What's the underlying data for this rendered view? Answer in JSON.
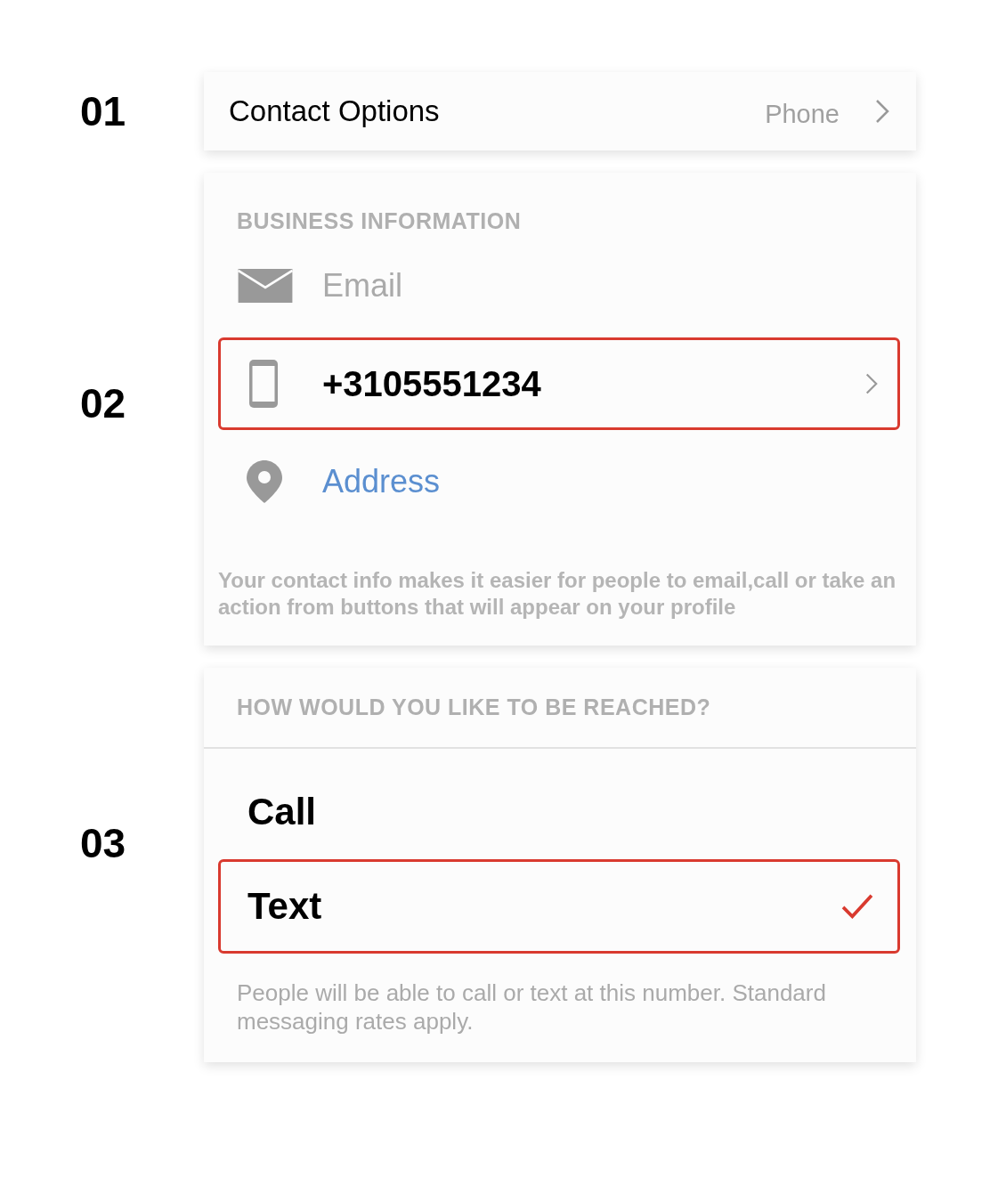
{
  "steps": [
    "01",
    "02",
    "03"
  ],
  "contact_options": {
    "label": "Contact Options",
    "value": "Phone"
  },
  "business_information": {
    "heading": "BUSINESS INFORMATION",
    "items": [
      {
        "kind": "email",
        "label": "Email",
        "highlighted": false
      },
      {
        "kind": "phone",
        "label": "+3105551234",
        "highlighted": true
      },
      {
        "kind": "address",
        "label": "Address",
        "highlighted": false
      }
    ],
    "note": "Your contact info makes it easier for people to email,call or take an action from buttons that will appear on your profile"
  },
  "reach": {
    "heading": "HOW WOULD YOU LIKE TO BE REACHED?",
    "options": [
      {
        "label": "Call",
        "selected": false
      },
      {
        "label": "Text",
        "selected": true
      }
    ],
    "note": "People will be able to call or text at this number. Standard messaging rates apply."
  }
}
